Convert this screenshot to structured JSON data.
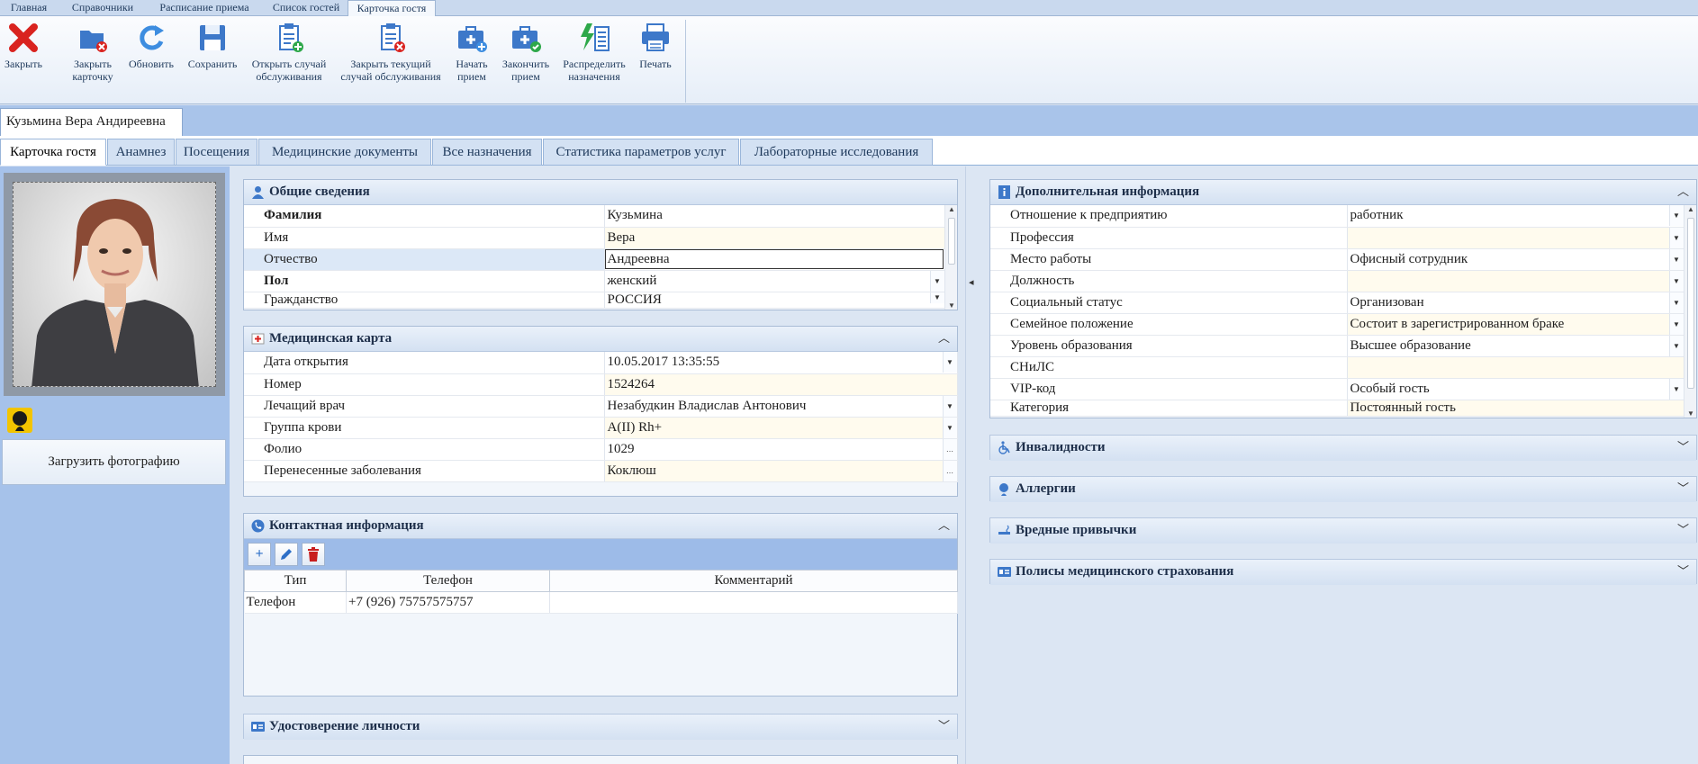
{
  "ribbon_tabs": [
    "Главная",
    "Справочники",
    "Расписание приема",
    "Список гостей",
    "Карточка гостя"
  ],
  "ribbon": {
    "close": "Закрыть",
    "close_card": [
      "Закрыть",
      "карточку"
    ],
    "refresh": "Обновить",
    "save": "Сохранить",
    "open_case": [
      "Открыть случай",
      "обслуживания"
    ],
    "close_case": [
      "Закрыть текущий",
      "случай обслуживания"
    ],
    "start": [
      "Начать",
      "прием"
    ],
    "finish": [
      "Закончить",
      "прием"
    ],
    "distribute": [
      "Распределить",
      "назначения"
    ],
    "print": "Печать"
  },
  "document_tab": "Кузьмина Вера Андиреевна",
  "sub_tabs": [
    "Карточка гостя",
    "Анамнез",
    "Посещения",
    "Медицинские документы",
    "Все назначения",
    "Статистика параметров услуг",
    "Лабораторные исследования"
  ],
  "left": {
    "upload_button": "Загрузить фотографию"
  },
  "general": {
    "title": "Общие сведения",
    "rows": [
      {
        "label": "Фамилия",
        "value": "Кузьмина"
      },
      {
        "label": "Имя",
        "value": "Вера"
      },
      {
        "label": "Отчество",
        "value": "Андреевна"
      },
      {
        "label": "Пол",
        "value": "женский"
      },
      {
        "label": "Гражданство",
        "value": "РОССИЯ"
      }
    ]
  },
  "medcard": {
    "title": "Медицинская карта",
    "rows": [
      {
        "label": "Дата открытия",
        "value": "10.05.2017 13:35:55"
      },
      {
        "label": "Номер",
        "value": "1524264"
      },
      {
        "label": "Лечащий врач",
        "value": "Незабудкин Владислав Антонович"
      },
      {
        "label": "Группа крови",
        "value": "A(II) Rh+"
      },
      {
        "label": "Фолио",
        "value": "1029"
      },
      {
        "label": "Перенесенные заболевания",
        "value": "Коклюш"
      }
    ]
  },
  "contacts": {
    "title": "Контактная информация",
    "columns": [
      "Тип",
      "Телефон",
      "Комментарий"
    ],
    "rows": [
      {
        "type": "Телефон",
        "phone": "+7 (926) 75757575757",
        "comment": ""
      }
    ]
  },
  "identity": {
    "title": "Удостоверение личности"
  },
  "additional": {
    "title": "Дополнительная информация",
    "rows": [
      {
        "label": "Отношение к предприятию",
        "value": "работник"
      },
      {
        "label": "Профессия",
        "value": ""
      },
      {
        "label": "Место работы",
        "value": "Офисный сотрудник"
      },
      {
        "label": "Должность",
        "value": ""
      },
      {
        "label": "Социальный статус",
        "value": "Организован"
      },
      {
        "label": "Семейное положение",
        "value": "Состоит в зарегистрированном браке"
      },
      {
        "label": "Уровень образования",
        "value": "Высшее образование"
      },
      {
        "label": "СНиЛС",
        "value": ""
      },
      {
        "label": "VIP-код",
        "value": "Особый гость"
      },
      {
        "label": "Категория",
        "value": "Постоянный гость"
      }
    ]
  },
  "collapsed_panels": [
    "Инвалидности",
    "Аллергии",
    "Вредные привычки",
    "Полисы медицинского страхования"
  ],
  "colors": {
    "accent": "#a9c4ea",
    "panel_header": "#d4e1f2",
    "close_red": "#d9231f"
  }
}
